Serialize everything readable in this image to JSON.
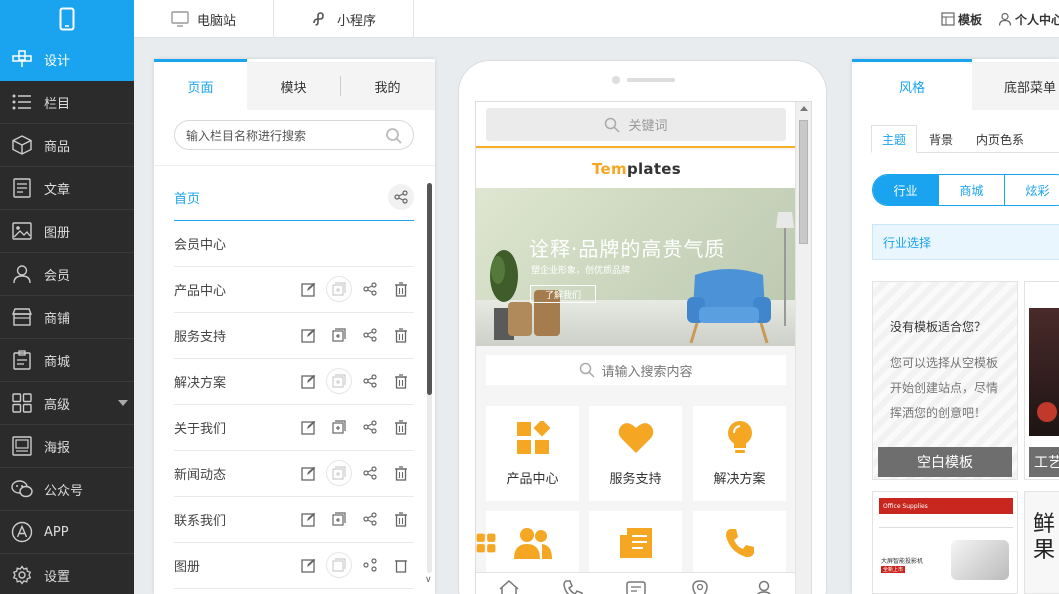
{
  "topbar": {
    "tabs": [
      {
        "label": "电脑站",
        "icon": "monitor-icon"
      },
      {
        "label": "小程序",
        "icon": "mini-program-icon"
      }
    ],
    "template_label": "模板",
    "user_label": "个人中心"
  },
  "sidenav": {
    "items": [
      {
        "label": "设计",
        "icon": "design-icon",
        "active": true
      },
      {
        "label": "栏目",
        "icon": "list-icon"
      },
      {
        "label": "商品",
        "icon": "box-icon"
      },
      {
        "label": "文章",
        "icon": "article-icon"
      },
      {
        "label": "图册",
        "icon": "gallery-icon"
      },
      {
        "label": "会员",
        "icon": "user-icon"
      },
      {
        "label": "商铺",
        "icon": "shop-icon"
      },
      {
        "label": "商城",
        "icon": "mall-icon"
      },
      {
        "label": "高级",
        "icon": "grid-icon",
        "has_caret": true
      },
      {
        "label": "海报",
        "icon": "poster-icon"
      },
      {
        "label": "公众号",
        "icon": "wechat-icon"
      },
      {
        "label": "APP",
        "icon": "app-icon"
      },
      {
        "label": "设置",
        "icon": "gear-icon"
      }
    ]
  },
  "pages_panel": {
    "tabs": [
      "页面",
      "模块",
      "我的"
    ],
    "active_tab": "页面",
    "search_placeholder": "输入栏目名称进行搜索",
    "pages": [
      {
        "name": "首页",
        "active": true
      },
      {
        "name": "会员中心"
      },
      {
        "name": "产品中心"
      },
      {
        "name": "服务支持"
      },
      {
        "name": "解决方案"
      },
      {
        "name": "关于我们"
      },
      {
        "name": "新闻动态"
      },
      {
        "name": "联系我们"
      },
      {
        "name": "图册"
      }
    ]
  },
  "phone": {
    "keyword_placeholder": "关键词",
    "site_logo_prefix": "Tem",
    "site_logo_rest": "plates",
    "banner": {
      "title": "诠释·品牌的高贵气质",
      "subtitle": "塑企业形象，创优质品牌",
      "button": "了解我们"
    },
    "search_placeholder": "请输入搜索内容",
    "grid": [
      {
        "label": "产品中心",
        "icon": "product-blocks-icon"
      },
      {
        "label": "服务支持",
        "icon": "heart-icon"
      },
      {
        "label": "解决方案",
        "icon": "lightbulb-icon"
      },
      {
        "label": "",
        "icon": "team-icon"
      },
      {
        "label": "",
        "icon": "news-icon"
      },
      {
        "label": "",
        "icon": "phone-icon"
      }
    ],
    "bottom_nav": [
      "home-icon",
      "phone-icon",
      "message-icon",
      "location-icon",
      "user-icon"
    ],
    "accent_color": "#f5a623"
  },
  "style_panel": {
    "tabs": [
      "风格",
      "底部菜单"
    ],
    "active_tab": "风格",
    "sub_tabs": [
      "主题",
      "背景",
      "内页色系"
    ],
    "active_sub_tab": "主题",
    "segments": [
      "行业",
      "商城",
      "炫彩"
    ],
    "active_segment": "行业",
    "industry_select": "行业选择",
    "blank_card": {
      "question": "没有模板适合您？",
      "line1": "您可以选择从空模板",
      "line2": "开始创建站点，尽情",
      "line3": "挥洒您的创意吧！",
      "button": "空白模板"
    },
    "card2_button": "工艺",
    "card3_header": "Office Supplies",
    "card3_text1": "大屏智能投影机",
    "card3_text2": "全新上市",
    "card4_text": "鲜果"
  },
  "colors": {
    "brand_blue": "#1aa3ee",
    "nav_bg": "#2b2b2b",
    "accent_orange": "#f5a623"
  }
}
